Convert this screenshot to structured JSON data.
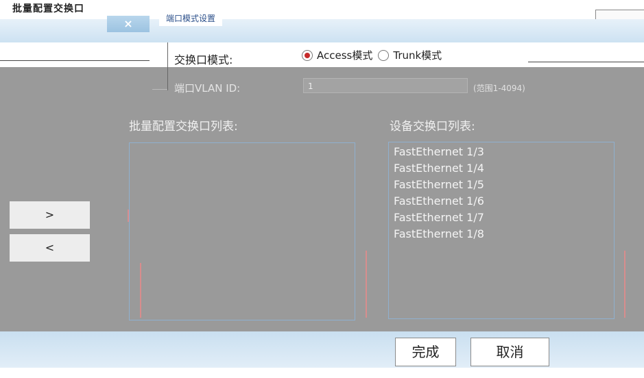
{
  "dialog": {
    "title": "批量配置交换口",
    "close_label": "×",
    "tab_label": "端口模式设置"
  },
  "mode": {
    "label": "交换口模式:",
    "options": [
      {
        "label": "Access模式",
        "checked": true
      },
      {
        "label": "Trunk模式",
        "checked": false
      }
    ]
  },
  "vlan": {
    "label": "端口VLAN ID:",
    "value": "1",
    "hint": "(范围1-4094)"
  },
  "lists": {
    "left_heading": "批量配置交换口列表:",
    "right_heading": "设备交换口列表:",
    "left_items": [],
    "right_items": [
      "FastEthernet 1/3",
      "FastEthernet 1/4",
      "FastEthernet 1/5",
      "FastEthernet 1/6",
      "FastEthernet 1/7",
      "FastEthernet 1/8"
    ]
  },
  "transfer": {
    "add_label": ">",
    "remove_label": "<"
  },
  "footer": {
    "done_label": "完成",
    "cancel_label": "取消"
  },
  "colors": {
    "panel_gray": "#9a9a9a",
    "list_border": "#8fb0cf",
    "radio_selected": "#c62b2b",
    "footer_blue": "#c9dff0"
  }
}
